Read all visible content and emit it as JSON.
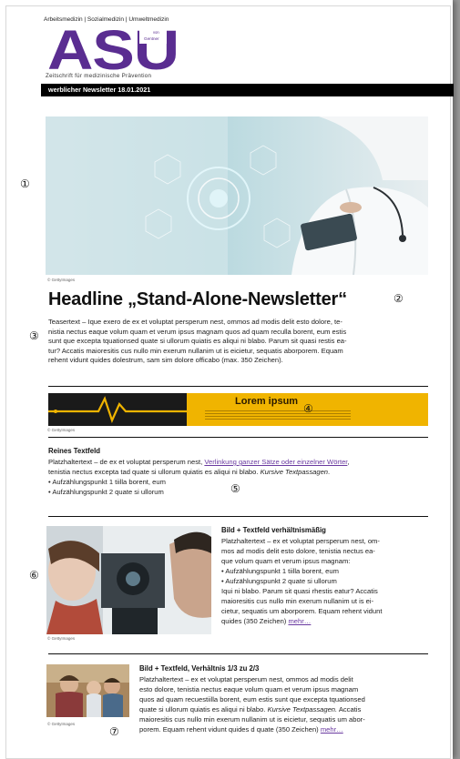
{
  "header": {
    "topline": "Arbeitsmedizin | Sozialmedizin | Umweltmedizin",
    "logo_text": "ASU",
    "logo_von": "von",
    "logo_brand": "Gentner",
    "tagline": "Zeitschrift für medizinische Prävention",
    "newsletter_bar": "werblicher Newsletter 18.01.2021"
  },
  "markers": [
    "①",
    "②",
    "③",
    "④",
    "⑤",
    "⑥",
    "⑦"
  ],
  "hero": {
    "credit": "© GettyImages"
  },
  "headline": "Headline „Stand-Alone-Newsletter“",
  "teaser": {
    "lines": [
      "Teasertext – Ique exero de ex et voluptat persperum nest, ommos ad modis delit esto dolore, te-",
      "nistia nectus eaque volum quam et verum ipsus magnam quos ad quam reculla borent, eum estis",
      "sunt que excepta tquationsed quate si ullorum quiatis es aliqui ni blabo. Parum sit quasi restis ea-",
      "tur? Accatis maioresitis cus nullo min exerum nullanim ut is eicietur, sequatis aborporem. Equam",
      "rehent vidunt quides dolestrum, sam sim dolore officabo (max. 350 Zeichen)."
    ]
  },
  "banner": {
    "title": "Lorem ipsum",
    "credit": "© GettyImages"
  },
  "text_section": {
    "title": "Reines Textfeld",
    "line1_before": "Platzhaltertext – de ex et voluptat persperum nest, ",
    "line1_link": "Verlinkung ganzer Sätze oder einzelner Wörter",
    "line1_after": ",",
    "line2_before": "tenistia nectus excepta tad quate si ullorum quiatis es aliqui ni blabo. ",
    "line2_italic": "Kursive Textpassagen",
    "line2_after": ".",
    "bullets": [
      "Aufzählungspunkt 1 tiilla borent, eum",
      "Aufzählungspunkt 2 quate si ullorum"
    ]
  },
  "img_section_1": {
    "credit": "© GettyImages",
    "title": "Bild + Textfeld verhältnismäßig",
    "lines_a": [
      "Platzhaltertext – ex et voluptat persperum nest, om-",
      "mos ad modis delit esto dolore, tenistia nectus ea-",
      "que volum quam et verum ipsus magnam:"
    ],
    "bullets": [
      "Aufzählungspunkt 1 tiilla borent, eum",
      "Aufzählungspunkt 2 quate si ullorum"
    ],
    "lines_b": [
      "Iqui ni blabo. Parum sit quasi rhestis eatur? Accatis",
      "maioresitis cus nullo min exerum nullanim ut is ei-",
      "cietur, sequatis um aborporem. Equam rehent vidunt"
    ],
    "last_line": "quides (350 Zeichen) ",
    "more_link": "mehr…"
  },
  "img_section_2": {
    "credit": "© GettyImages",
    "title": "Bild + Textfeld, Verhältnis 1/3 zu 2/3",
    "lines": [
      "Platzhaltertext – ex et voluptat persperum nest, ommos ad modis delit",
      "esto dolore, tenistia nectus eaque volum quam et verum ipsus magnam",
      "quos ad quam recuestiilla borent, eum estis sunt que excepta tquationsed"
    ],
    "line4_before": "quate si ullorum quiatis es aliqui ni blabo. ",
    "line4_italic": "Kursive Textpassagen.",
    "line4_after": " Accatis",
    "line5": "maioresitis cus nullo min exerum nullanim ut is eicietur, sequatis um abor-",
    "line6_before": "porem. Equam rehent vidunt quides d quate (350 Zeichen) ",
    "more_link": "mehr…"
  },
  "colors": {
    "accent": "#6a3aa0",
    "logo": "#5a2d91",
    "banner": "#f0b400"
  }
}
